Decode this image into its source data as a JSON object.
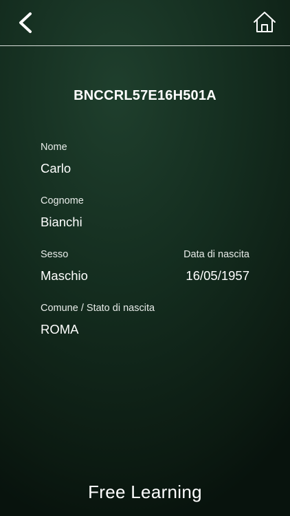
{
  "header": {
    "back_icon": "chevron-left-icon",
    "home_icon": "home-icon"
  },
  "fiscal_code": "BNCCRL57E16H501A",
  "fields": {
    "nome": {
      "label": "Nome",
      "value": "Carlo"
    },
    "cognome": {
      "label": "Cognome",
      "value": "Bianchi"
    },
    "sesso": {
      "label": "Sesso",
      "value": "Maschio"
    },
    "data_nascita": {
      "label": "Data di nascita",
      "value": "16/05/1957"
    },
    "comune": {
      "label": "Comune / Stato di nascita",
      "value": "ROMA"
    }
  },
  "footer": {
    "logo_text": "Free Learning"
  },
  "colors": {
    "background": "#142d1f",
    "text": "#ffffff",
    "divider": "#d9dfdb"
  }
}
